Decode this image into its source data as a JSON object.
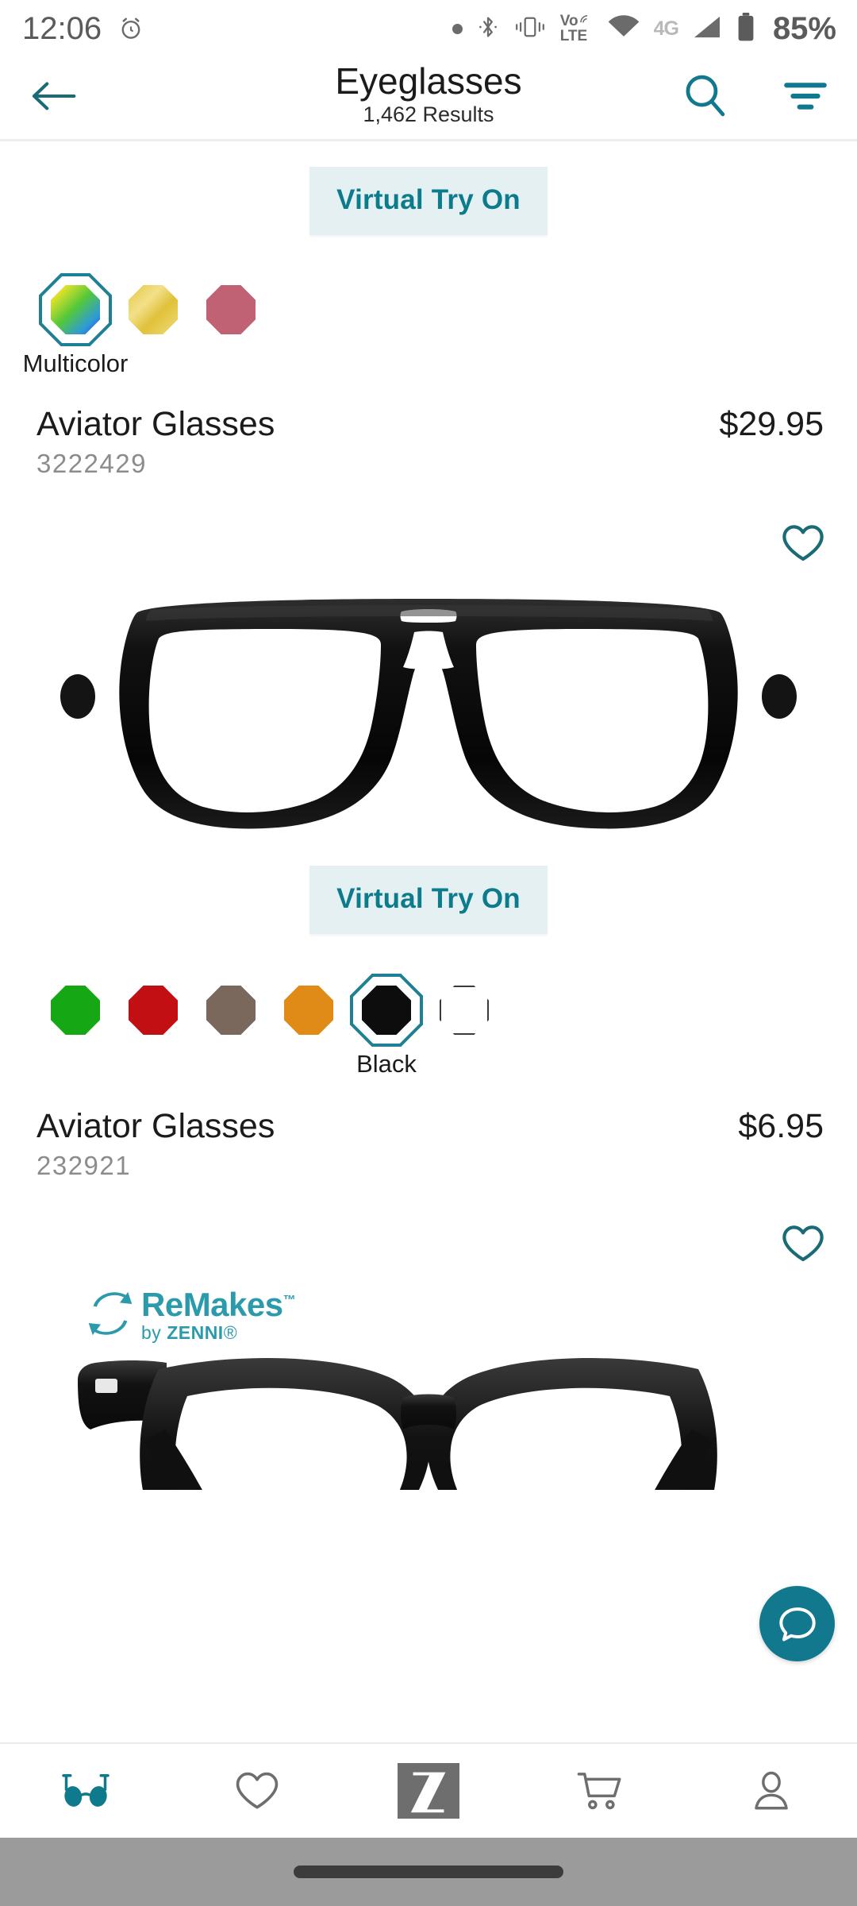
{
  "status_bar": {
    "time": "12:06",
    "alarm_icon": "alarm-icon",
    "dot_icon": "dot-icon",
    "bluetooth_icon": "bluetooth-icon",
    "vibrate_icon": "vibrate-icon",
    "volte_top": "Vo",
    "volte_bottom": "LTE",
    "wifi_icon": "wifi-icon",
    "network_label": "4G",
    "signal_icon": "signal-icon",
    "battery_icon": "battery-icon",
    "battery_percent": "85%"
  },
  "header": {
    "back_icon": "back-arrow-icon",
    "title": "Eyeglasses",
    "results": "1,462 Results",
    "search_icon": "search-icon",
    "filter_icon": "filter-icon"
  },
  "theme": {
    "teal": "#11788d",
    "teal_light": "#e5f0f2",
    "accent_ring": "#1f7f94",
    "text_dark": "#1b1b1b",
    "text_muted": "#8c8c8c"
  },
  "products": [
    {
      "vto_label": "Virtual Try On",
      "colors": [
        {
          "name": "Multicolor",
          "hex": "multicolor",
          "selected": true
        },
        {
          "name": "Gold",
          "hex": "#e8cf5d",
          "selected": false
        },
        {
          "name": "Rose",
          "hex": "#c06274",
          "selected": false
        }
      ],
      "selected_color_label": "Multicolor",
      "name": "Aviator Glasses",
      "sku": "3222429",
      "price": "$29.95",
      "favorite_icon": "heart-outline-icon",
      "image_alt": "black-aviator-eyeglasses"
    },
    {
      "vto_label": "Virtual Try On",
      "colors": [
        {
          "name": "Green",
          "hex": "#16a814",
          "selected": false
        },
        {
          "name": "Red",
          "hex": "#c20f14",
          "selected": false
        },
        {
          "name": "Brown",
          "hex": "#7b685c",
          "selected": false
        },
        {
          "name": "Orange",
          "hex": "#e08b17",
          "selected": false
        },
        {
          "name": "Black",
          "hex": "#0d0d0d",
          "selected": true
        },
        {
          "name": "White",
          "hex": "#ffffff",
          "selected": false
        }
      ],
      "selected_color_label": "Black",
      "name": "Aviator Glasses",
      "sku": "232921",
      "price": "$6.95",
      "favorite_icon": "heart-outline-icon",
      "brand_logo": {
        "icon": "recycle-arrows-icon",
        "main": "ReMakes",
        "trademark": "™",
        "sub_prefix": "by ",
        "sub_brand": "ZENNI",
        "sub_mark": "®"
      },
      "image_alt": "black-round-eyeglasses"
    }
  ],
  "chat_fab": {
    "icon": "chat-bubble-icon"
  },
  "bottom_nav": [
    {
      "name": "shop-glasses",
      "icon": "glasses-icon",
      "active": true
    },
    {
      "name": "favorites",
      "icon": "heart-outline-icon",
      "active": false
    },
    {
      "name": "zenni-home",
      "icon": "zenni-logo-icon",
      "active": false
    },
    {
      "name": "cart",
      "icon": "cart-icon",
      "active": false
    },
    {
      "name": "account",
      "icon": "person-icon",
      "active": false
    }
  ],
  "gesture_bar": {
    "handle": "home-indicator"
  }
}
